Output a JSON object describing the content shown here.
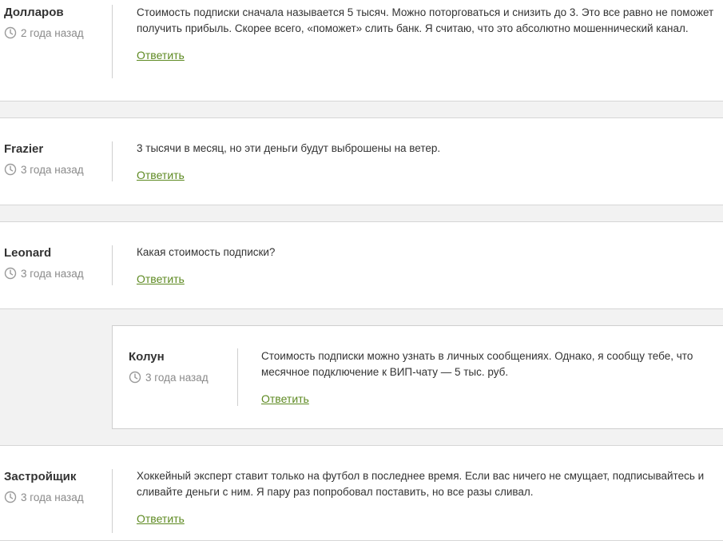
{
  "reply_label": "Ответить",
  "comments": [
    {
      "author": "Долларов",
      "time": "2 года назад",
      "text": "Стоимость подписки сначала называется 5 тысяч. Можно поторговаться и снизить до 3. Это все равно не поможет получить прибыль. Скорее всего, «поможет» слить банк. Я считаю, что это абсолютно мошеннический канал."
    },
    {
      "author": "Frazier",
      "time": "3 года назад",
      "text": "3 тысячи в месяц, но эти деньги будут выброшены на ветер."
    },
    {
      "author": "Leonard",
      "time": "3 года назад",
      "text": "Какая стоимость подписки?"
    },
    {
      "author": "Колун",
      "time": "3 года назад",
      "text": "Стоимость подписки можно узнать в личных сообщениях. Однако, я сообщу тебе, что месячное подключение к ВИП-чату — 5 тыс. руб."
    },
    {
      "author": "Застройщик",
      "time": "3 года назад",
      "text": "Хоккейный эксперт ставит только на футбол в последнее время. Если вас ничего не смущает, подписывайтесь и сливайте деньги с ним. Я пару раз попробовал поставить, но все разы сливал."
    }
  ]
}
